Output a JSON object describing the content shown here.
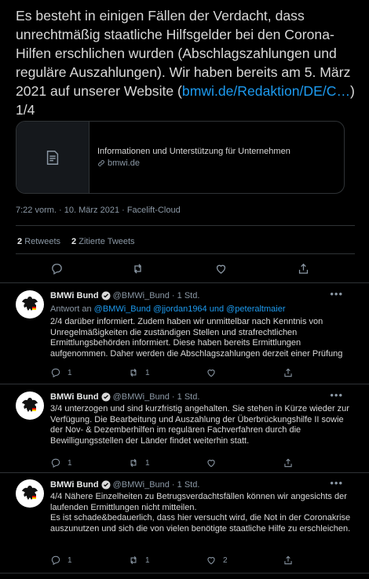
{
  "main_tweet": {
    "text": "Es besteht in einigen Fällen der Verdacht, dass unrechtmäßig staatliche Hilfsgelder bei den Corona-Hilfen erschlichen wurden (Abschlagszahlungen und reguläre Auszahlungen). Wir haben bereits am 5. März 2021 auf unserer Website (",
    "link_text": "bmwi.de/Redaktion/DE/C…",
    "text_end": ")\n1/4",
    "card": {
      "title": "Informationen und Unterstützung für Unternehmen",
      "domain": "bmwi.de",
      "icon": "document-icon"
    },
    "timestamp": "7:22 vorm. · 10. März 2021 · Facelift-Cloud",
    "retweets_count": "2",
    "retweets_label": "Retweets",
    "quotes_count": "2",
    "quotes_label": "Zitierte Tweets"
  },
  "replies": [
    {
      "name": "BMWi Bund",
      "handle": "@BMWi_Bund",
      "time": "· 1 Std.",
      "reply_to_prefix": "Antwort an",
      "reply_to_mentions": "@BMWi_Bund @jjordan1964 und @peteraltmaier",
      "text": "2/4 darüber informiert. Zudem haben wir unmittelbar nach Kenntnis von Unregelmäßigkeiten die zuständigen Stellen und strafrechtlichen Ermittlungsbehörden informiert. Diese haben bereits Ermittlungen aufgenommen. Daher werden die Abschlagszahlungen derzeit einer Prüfung",
      "replies": "1",
      "retweets": "1",
      "likes": ""
    },
    {
      "name": "BMWi Bund",
      "handle": "@BMWi_Bund",
      "time": "· 1 Std.",
      "text": "3/4 unterzogen und sind kurzfristig angehalten. Sie stehen in Kürze wieder zur Verfügung. Die Bearbeitung und Auszahlung der Überbrückungshilfe II sowie der Nov- & Dezemberhilfen im regulären Fachverfahren durch die Bewilligungsstellen der Länder findet weiterhin statt.",
      "replies": "1",
      "retweets": "1",
      "likes": ""
    },
    {
      "name": "BMWi Bund",
      "handle": "@BMWi_Bund",
      "time": "· 1 Std.",
      "text": "4/4 Nähere Einzelheiten zu Betrugsverdachtsfällen können wir angesichts der laufenden Ermittlungen nicht mitteilen.\nEs ist schade&bedauerlich, dass hier versucht wird, die Not in der Coronakrise auszunutzen und sich die von vielen benötigte staatliche Hilfe zu erschleichen.",
      "replies": "1",
      "retweets": "1",
      "likes": "2"
    }
  ],
  "colors": {
    "background": "#000000",
    "text": "#d9d9d9",
    "muted": "#8b98a5",
    "link": "#1d9bf0",
    "border": "#2f3336"
  }
}
